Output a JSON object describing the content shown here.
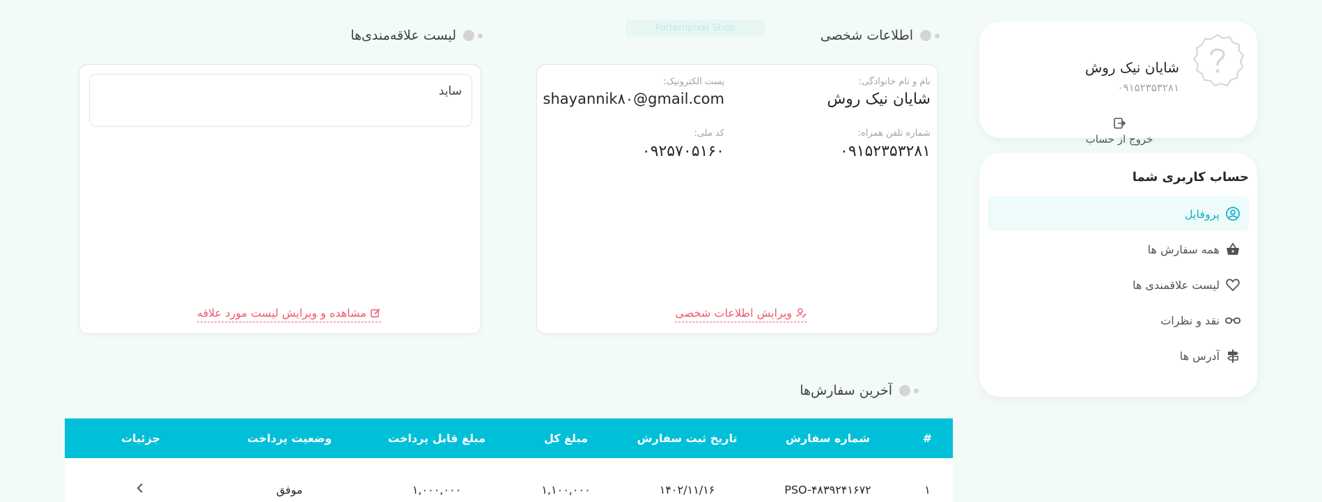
{
  "watermark": "Patternpixel Shop",
  "profile": {
    "name": "شایان نیک روش",
    "phone": "۰۹۱۵۲۳۵۳۲۸۱",
    "logout_label": "خروج از حساب"
  },
  "menu": {
    "title": "حساب کاربری شما",
    "items": [
      {
        "label": "پروفایل",
        "icon": "user-circle-icon",
        "active": true
      },
      {
        "label": "همه سفارش ها",
        "icon": "basket-icon"
      },
      {
        "label": "لیست علاقمندی ها",
        "icon": "heart-icon"
      },
      {
        "label": "نقد و نظرات",
        "icon": "glasses-icon"
      },
      {
        "label": "آدرس ها",
        "icon": "signpost-icon"
      }
    ]
  },
  "personal": {
    "section_title": "اطلاعات شخصی",
    "name_label": "نام و نام خانوادگی:",
    "name_value": "شایان نیک روش",
    "email_label": "پست الکترونیک:",
    "email_value": "shayannik۸۰@gmail.com",
    "mobile_label": "شماره تلفن همراه:",
    "mobile_value": "۰۹۱۵۲۳۵۳۲۸۱",
    "national_label": "کد ملی:",
    "national_value": "۰۹۲۵۷۰۵۱۶۰",
    "edit_link": "ویرایش اطلاعات شخصی"
  },
  "wishlist": {
    "section_title": "لیست علاقه‌مندی‌ها",
    "item": "ساید",
    "edit_link": "مشاهده و ویرایش لیست مورد علاقه"
  },
  "orders": {
    "section_title": "آخرین سفارش‌ها",
    "headers": [
      "#",
      "شماره سفارش",
      "تاریخ ثبت سفارش",
      "مبلغ کل",
      "مبلغ قابل پرداخت",
      "وضعیت پرداخت",
      "جزئیات"
    ],
    "rows": [
      [
        "۱",
        "PSO-۴۸۳۹۲۴۱۶۷۲",
        "۱۴۰۲/۱۱/۱۶",
        "۱,۱۰۰,۰۰۰",
        "۱,۰۰۰,۰۰۰",
        "موفق"
      ]
    ]
  },
  "colors": {
    "accent": "#00c0d9",
    "link": "#ef5a6f",
    "background": "#f3fbf9"
  }
}
